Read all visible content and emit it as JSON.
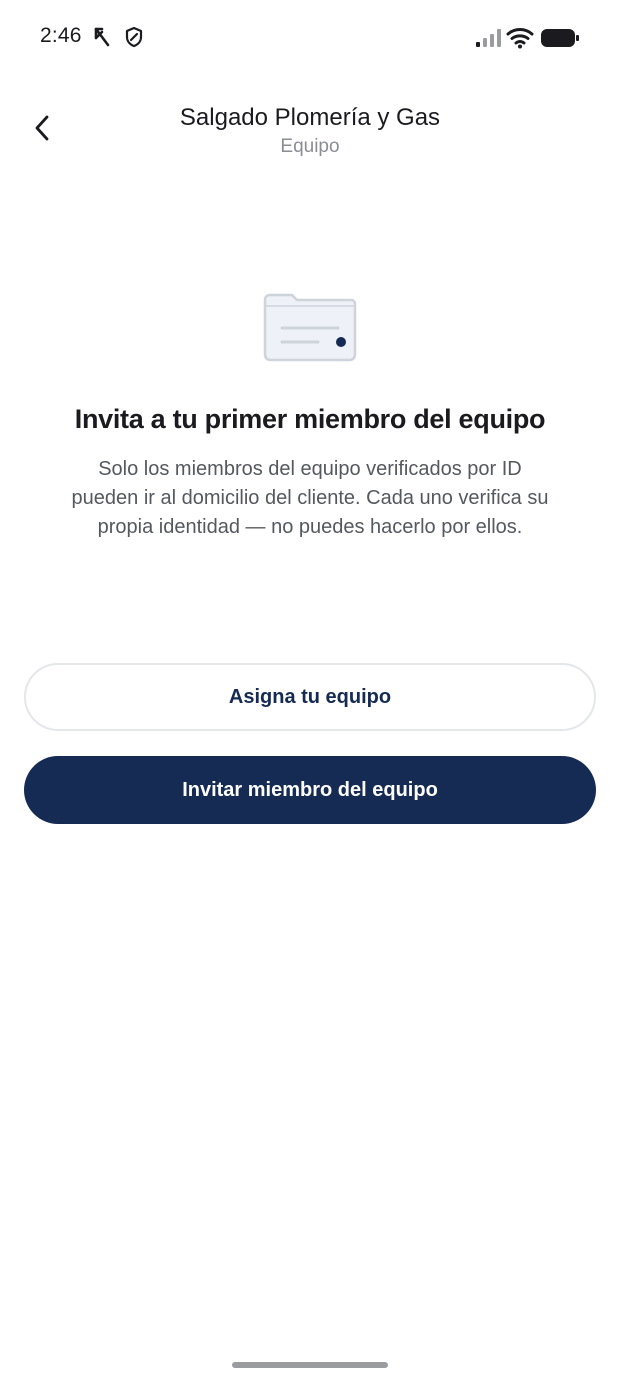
{
  "status_bar": {
    "time": "2:46",
    "icons": [
      "k-notification-icon",
      "shield-icon",
      "signal-icon",
      "wifi-icon",
      "battery-icon"
    ]
  },
  "header": {
    "back_icon": "chevron-left-icon",
    "title": "Salgado Plomería y Gas",
    "subtitle": "Equipo"
  },
  "empty_state": {
    "illustration_icon": "folder-card-icon",
    "title": "Invita a tu primer miembro del equipo",
    "body": "Solo los miembros del equipo verificados por ID pueden ir al domicilio del cliente. Cada uno verifica su propia identidad — no puedes hacerlo por ellos."
  },
  "actions": {
    "assign_label": "Asigna tu equipo",
    "invite_label": "Invitar miembro del equipo"
  },
  "colors": {
    "primary": "#152b54",
    "secondary_border": "#e4e6ea",
    "text_primary": "#1b1b1f",
    "text_secondary": "#55585e",
    "illustration_fill": "#eef1f8"
  }
}
